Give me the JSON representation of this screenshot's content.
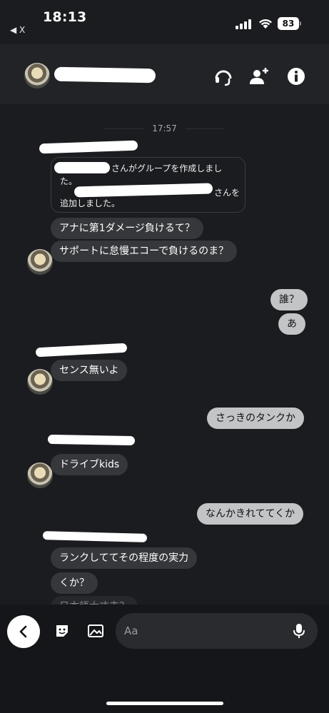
{
  "status_bar": {
    "time": "18:13",
    "back_label": "◀ X",
    "battery": "83"
  },
  "header": {
    "avatar_icon": "avatar",
    "actions": [
      "headset-icon",
      "add-person-icon",
      "info-icon"
    ]
  },
  "chat": {
    "timestamp": "17:57",
    "system_message": {
      "line1": "さんがグループを作成しまし",
      "line2": "た。",
      "line3": "さんを",
      "line4": "追加しました。"
    },
    "incoming_1": "アナに第1ダメージ負けるて？",
    "incoming_2": "サポートに怠慢エコーで負けるのま？",
    "outgoing_1": "誰？",
    "outgoing_2": "あ",
    "incoming_3": "センス無いよ",
    "outgoing_3": "さっきのタンクか",
    "incoming_4": "ドライブkids",
    "outgoing_4": "なんかきれててくか",
    "incoming_5": "ランクしててその程度の実力",
    "incoming_6": "くか？",
    "incoming_7_partial": "日本語大丈夫？"
  },
  "composer": {
    "placeholder": "Aa"
  },
  "colors": {
    "background": "#1b1c1f",
    "incoming_bubble": "#36373b",
    "outgoing_bubble": "#c3c4c6"
  }
}
